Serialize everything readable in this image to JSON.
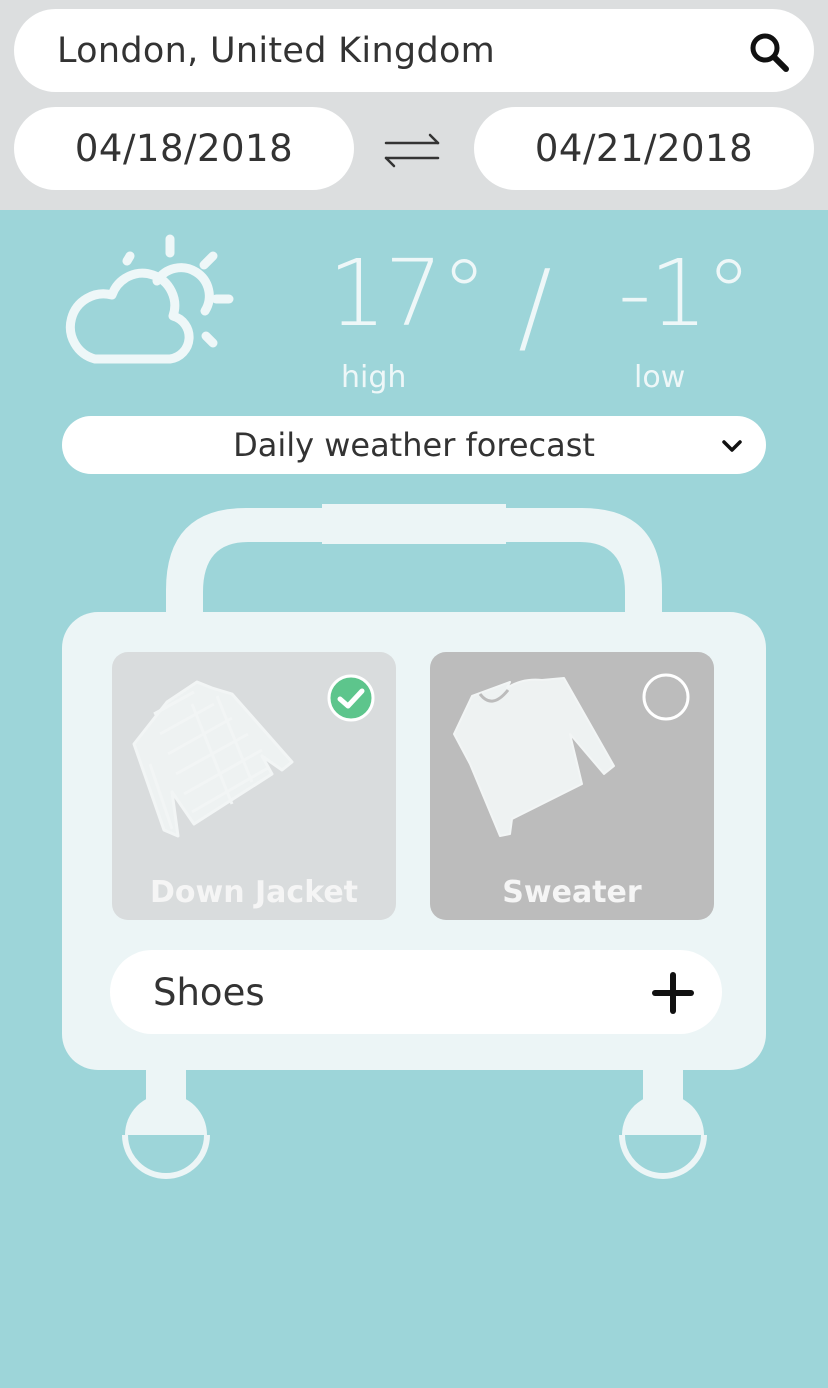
{
  "search": {
    "location": "London, United Kingdom"
  },
  "dates": {
    "start": "04/18/2018",
    "end": "04/21/2018"
  },
  "weather": {
    "high_value": "17°",
    "separator": "/",
    "low_value": "-1°",
    "high_label": "high",
    "low_label": "low",
    "icon": "partly-cloudy-icon"
  },
  "forecast_select": {
    "selected": "Daily weather forecast"
  },
  "items": [
    {
      "label": "Down Jacket",
      "checked": true,
      "icon": "down-jacket-icon"
    },
    {
      "label": "Sweater",
      "checked": false,
      "icon": "sweater-icon"
    }
  ],
  "category_row": {
    "label": "Shoes"
  },
  "colors": {
    "background": "#9dd5d9",
    "top_bar": "#dcdedf",
    "check_green": "#5dc58c",
    "suitcase": "#ecf5f6"
  }
}
